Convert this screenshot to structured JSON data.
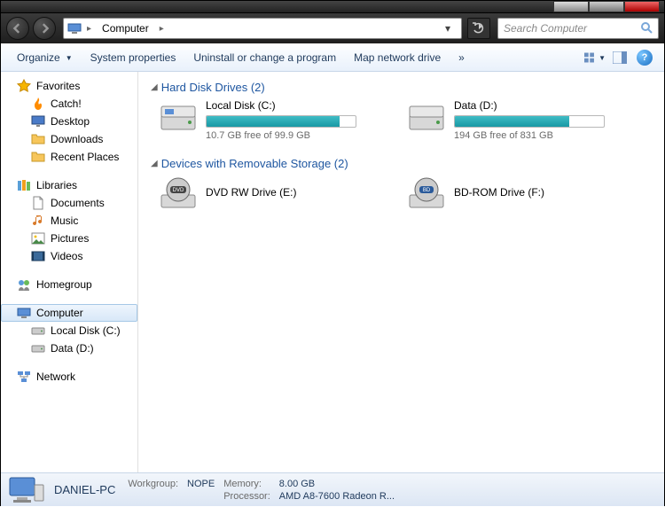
{
  "nav": {
    "location": "Computer",
    "search_placeholder": "Search Computer"
  },
  "toolbar": {
    "organize": "Organize",
    "system_properties": "System properties",
    "uninstall": "Uninstall or change a program",
    "map_drive": "Map network drive",
    "more": "»"
  },
  "sidebar": {
    "favorites": "Favorites",
    "fav_items": [
      "Catch!",
      "Desktop",
      "Downloads",
      "Recent Places"
    ],
    "libraries": "Libraries",
    "lib_items": [
      "Documents",
      "Music",
      "Pictures",
      "Videos"
    ],
    "homegroup": "Homegroup",
    "computer": "Computer",
    "comp_items": [
      "Local Disk (C:)",
      "Data (D:)"
    ],
    "network": "Network"
  },
  "groups": {
    "hdd": {
      "title": "Hard Disk Drives (2)"
    },
    "removable": {
      "title": "Devices with Removable Storage (2)"
    }
  },
  "drives": {
    "c": {
      "name": "Local Disk (C:)",
      "free": "10.7 GB free of 99.9 GB",
      "fill_pct": 89
    },
    "d": {
      "name": "Data (D:)",
      "free": "194 GB free of 831 GB",
      "fill_pct": 77
    },
    "e": {
      "name": "DVD RW Drive (E:)"
    },
    "f": {
      "name": "BD-ROM Drive (F:)"
    }
  },
  "status": {
    "pc_name": "DANIEL-PC",
    "workgroup_label": "Workgroup:",
    "workgroup": "NOPE",
    "memory_label": "Memory:",
    "memory": "8.00 GB",
    "processor_label": "Processor:",
    "processor": "AMD A8-7600 Radeon R..."
  }
}
